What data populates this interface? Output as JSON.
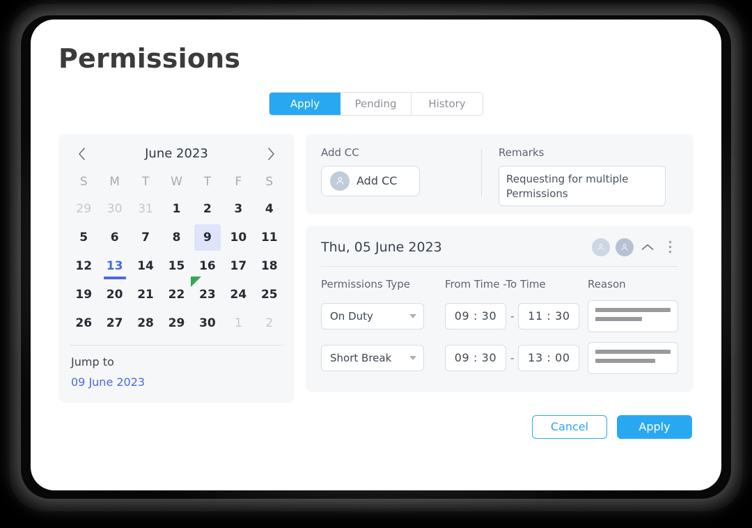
{
  "page": {
    "title": "Permissions",
    "accent_blue": "#29a8f2",
    "accent_indigo": "#4a69e2",
    "selected_day_bg": "#dfe3fb",
    "panel_bg": "#f6f7f8",
    "cursor_color": "#34a853"
  },
  "tabs": [
    {
      "label": "Apply",
      "active": true
    },
    {
      "label": "Pending",
      "active": false
    },
    {
      "label": "History",
      "active": false
    }
  ],
  "calendar": {
    "prev_icon": "chevron-left-icon",
    "next_icon": "chevron-right-icon",
    "month_title": "June 2023",
    "day_headers": [
      "S",
      "M",
      "T",
      "W",
      "T",
      "F",
      "S"
    ],
    "weeks": [
      [
        {
          "n": "29",
          "muted": true
        },
        {
          "n": "30",
          "muted": true
        },
        {
          "n": "31",
          "muted": true
        },
        {
          "n": "1"
        },
        {
          "n": "2"
        },
        {
          "n": "3"
        },
        {
          "n": "4"
        }
      ],
      [
        {
          "n": "5"
        },
        {
          "n": "6"
        },
        {
          "n": "7"
        },
        {
          "n": "8"
        },
        {
          "n": "9",
          "selected": true
        },
        {
          "n": "10"
        },
        {
          "n": "11"
        }
      ],
      [
        {
          "n": "12"
        },
        {
          "n": "13",
          "today": true
        },
        {
          "n": "14"
        },
        {
          "n": "15"
        },
        {
          "n": "16"
        },
        {
          "n": "17"
        },
        {
          "n": "18"
        }
      ],
      [
        {
          "n": "19"
        },
        {
          "n": "20"
        },
        {
          "n": "21"
        },
        {
          "n": "22"
        },
        {
          "n": "23"
        },
        {
          "n": "24"
        },
        {
          "n": "25"
        }
      ],
      [
        {
          "n": "26"
        },
        {
          "n": "27"
        },
        {
          "n": "28"
        },
        {
          "n": "29"
        },
        {
          "n": "30"
        },
        {
          "n": "1",
          "muted": true
        },
        {
          "n": "2",
          "muted": true
        }
      ]
    ],
    "jump_to_label": "Jump to",
    "jump_to_value": "09 June 2023"
  },
  "cc": {
    "label": "Add CC",
    "button_label": "Add CC",
    "button_icon": "person-icon"
  },
  "remarks": {
    "label": "Remarks",
    "value": "Requesting for multiple Permissions"
  },
  "detail": {
    "date": "Thu, 05 June 2023",
    "avatars": [
      {
        "name": "avatar-assignee-1",
        "icon": "person-icon"
      },
      {
        "name": "avatar-assignee-2",
        "icon": "person-icon"
      }
    ],
    "collapse_icon": "chevron-up-icon",
    "menu_icon": "more-vertical-icon",
    "columns": {
      "type": "Permissions Type",
      "time": "From Time -To Time",
      "reason": "Reason"
    },
    "rows": [
      {
        "type": "On Duty",
        "from_time": "09 : 30",
        "separator": "-",
        "to_time": "11 : 30",
        "reason_bars": [
          100,
          62
        ]
      },
      {
        "type": "Short Break",
        "from_time": "09 : 30",
        "separator": "-",
        "to_time": "13 : 00",
        "reason_bars": [
          100,
          80
        ]
      }
    ]
  },
  "footer": {
    "cancel_label": "Cancel",
    "apply_label": "Apply"
  }
}
